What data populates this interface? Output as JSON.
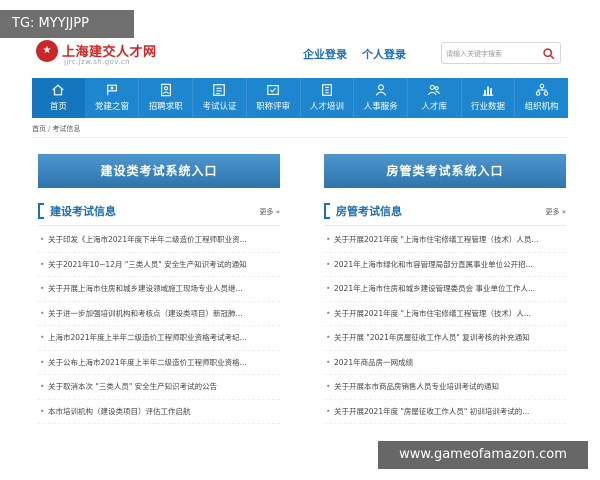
{
  "colors": {
    "nav_bg": "#1d86cf",
    "nav_active_bg": "#1576be",
    "banner_bg": "#3a82be",
    "accent_blue": "#1e6fb3",
    "brand_red": "#c62828"
  },
  "watermarks": {
    "top_left": "TG: MYYJJPP",
    "bottom_right": "www.gameofamazon.com"
  },
  "header": {
    "logo_icon": "seal-logo-icon",
    "site_name": "上海建交人才网",
    "site_domain": "jjrc.jzw.sh.gov.cn",
    "enterprise_login": "企业登录",
    "personal_login": "个人登录",
    "search": {
      "placeholder": "请输入关键字搜索",
      "value": "",
      "icon": "search-icon"
    }
  },
  "nav": {
    "items": [
      {
        "label": "首页",
        "icon": "home-icon"
      },
      {
        "label": "党建之窗",
        "icon": "party-flag-icon"
      },
      {
        "label": "招聘求职",
        "icon": "resume-icon"
      },
      {
        "label": "考试认证",
        "icon": "certificate-icon"
      },
      {
        "label": "职称评审",
        "icon": "review-icon"
      },
      {
        "label": "人才培训",
        "icon": "training-icon"
      },
      {
        "label": "人事服务",
        "icon": "person-service-icon"
      },
      {
        "label": "人才库",
        "icon": "talent-pool-icon"
      },
      {
        "label": "行业数据",
        "icon": "bar-chart-icon"
      },
      {
        "label": "组织机构",
        "icon": "org-chart-icon"
      }
    ]
  },
  "breadcrumb": {
    "home": "首页",
    "separator": "/",
    "current": "考试信息"
  },
  "left": {
    "banner": "建设类考试系统入口",
    "section_title": "建设考试信息",
    "more": "更多 »",
    "items": [
      "关于印发《上海市2021年度下半年二级造价工程师职业资...",
      "关于2021年10~12月 \"三类人员\" 安全生产知识考试的通知",
      "关于开展上海市住房和城乡建设领域施工现场专业人员继...",
      "关于进一步加强培训机构和考核点（建设类项目）新冠肺...",
      "上海市2021年度上半年二级造价工程师职业资格考试考纪...",
      "关于公布上海市2021年度上半年二级造价工程师职业资格...",
      "关于取消本次 \"三类人员\" 安全生产知识考试的公告",
      "本市培训机构（建设类项目）评估工作启航"
    ]
  },
  "right": {
    "banner": "房管类考试系统入口",
    "section_title": "房管考试信息",
    "more": "更多 »",
    "items": [
      "关于开展2021年度 \"上海市住宅修缮工程管理（技术）人员...",
      "2021年上海市绿化和市容管理局部分直属事业单位公开招...",
      "2021年上海市住房和城乡建设管理委员会 事业单位工作人...",
      "关于开展2021年度 \"上海市住宅修缮工程管理（技术）人...",
      "关于开展 \"2021年房屋征收工作人员\" 复训考核的补充通知",
      "2021年商品房一网成绩",
      "关于开展本市商品房销售人员专业培训考试的通知",
      "关于开展2021年度 \"房屋征收工作人员\" 初训培训考试的..."
    ]
  }
}
